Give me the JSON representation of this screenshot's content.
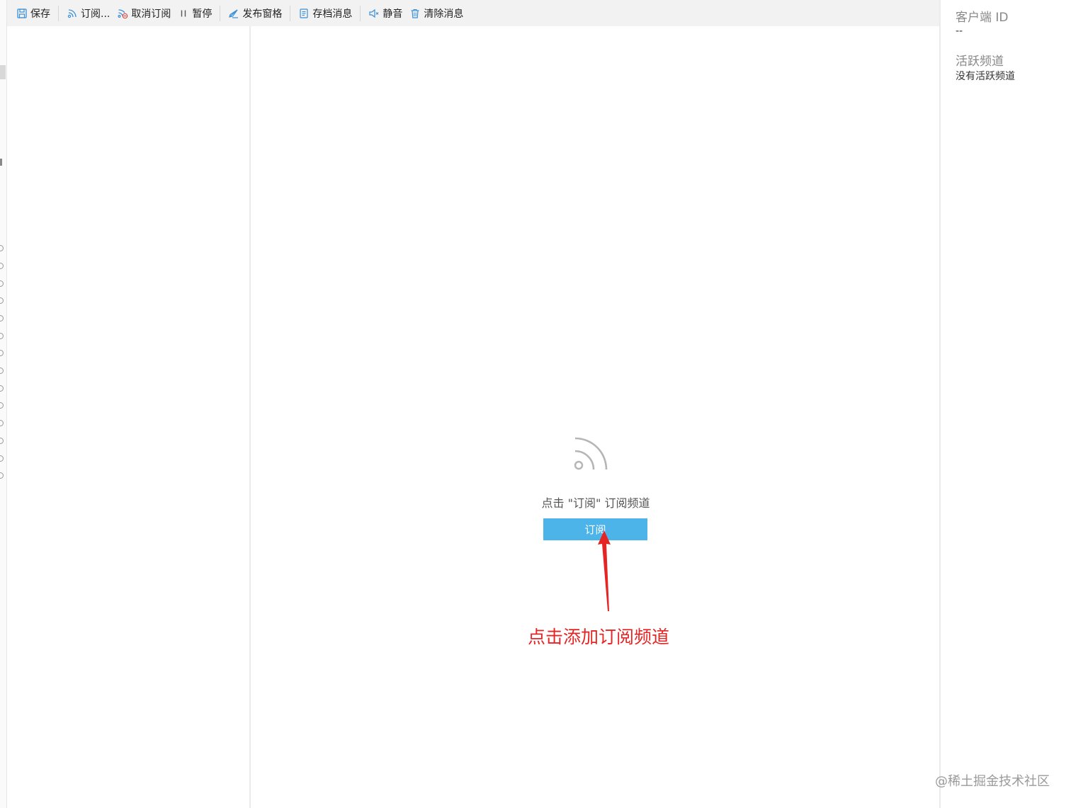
{
  "toolbar": {
    "save": "保存",
    "subscribe": "订阅...",
    "unsubscribe": "取消订阅",
    "pause": "暂停",
    "publish_pane": "发布窗格",
    "archive_messages": "存档消息",
    "mute": "静音",
    "clear_messages": "清除消息"
  },
  "sidebar_info": {
    "client_id_label": "客户端 ID",
    "client_id_value": "--",
    "active_channels_label": "活跃频道",
    "active_channels_value": "没有活跃频道"
  },
  "empty_state": {
    "icon": "rss-icon",
    "message": "点击 \"订阅\" 订阅频道",
    "button_label": "订阅"
  },
  "annotation": {
    "text": "点击添加订阅频道",
    "color": "#e52424"
  },
  "watermark": "@稀土掘金技术社区",
  "colors": {
    "accent_button": "#4db4ea",
    "toolbar_bg": "#f2f2f2",
    "icon_blue": "#3a8fd6"
  }
}
